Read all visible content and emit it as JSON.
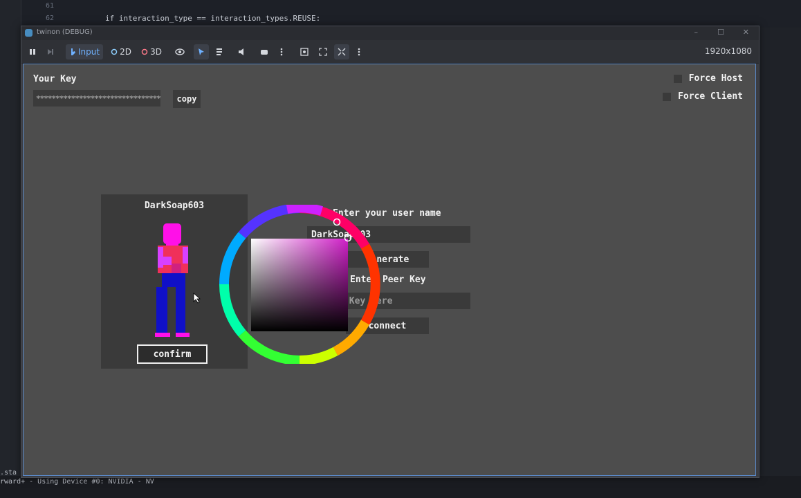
{
  "editor": {
    "lines": [
      {
        "num": "61",
        "code": ""
      },
      {
        "num": "62",
        "code": "if interaction_type == interaction_types.REUSE:"
      }
    ],
    "bottom_lines": [
      ".sta",
      "rward+ - Using Device #0: NVIDIA - NV"
    ]
  },
  "window": {
    "title": "twinon (DEBUG)",
    "controls": [
      "–",
      "☐",
      "✕"
    ]
  },
  "toolbar": {
    "input_label": "Input",
    "mode_2d_label": "2D",
    "mode_3d_label": "3D",
    "resolution": "1920x1080"
  },
  "game": {
    "your_key_label": "Your Key",
    "key_value": "********************************",
    "copy_label": "copy",
    "force_host_label": "Force Host",
    "force_client_label": "Force Client",
    "character": {
      "name": "DarkSoap603",
      "confirm_label": "confirm",
      "colors": {
        "head": "#ff10e8",
        "shirt": "#f0305a",
        "shirt_alt": "#d840ff",
        "pants": "#1010c8",
        "shoes": "#ff10e8"
      }
    },
    "username_label": "Enter your user name",
    "username_value": "DarkSoap603",
    "generate_label": "Generate",
    "peer_key_label": "Enter Peer Key",
    "peer_key_placeholder": "Friend Key here",
    "connect_label": "connect"
  },
  "icons": {
    "pause": "pause-icon",
    "step": "step-forward-icon",
    "eye": "eye-icon",
    "select": "select-arrow-icon",
    "list": "list-icon",
    "audio": "speaker-icon",
    "camera": "camera-icon",
    "more": "more-vertical-icon"
  }
}
